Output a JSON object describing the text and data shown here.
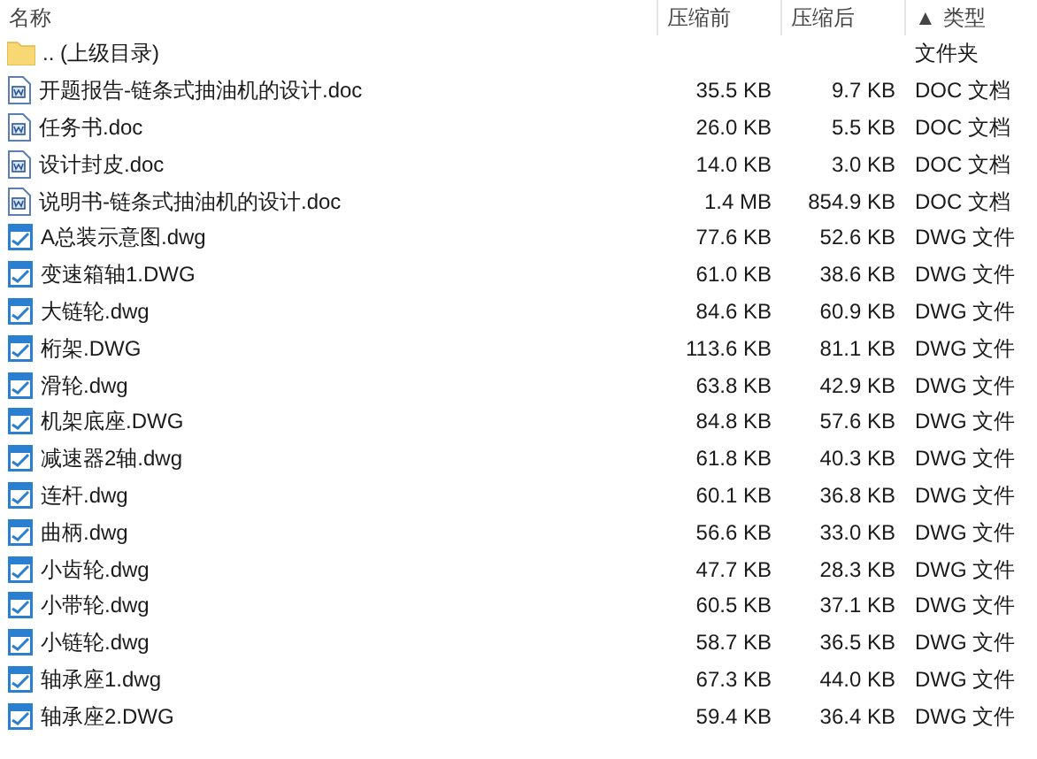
{
  "columns": [
    {
      "label": "名称"
    },
    {
      "label": "压缩前"
    },
    {
      "label": "压缩后"
    },
    {
      "label": "类型",
      "sort": "▲"
    }
  ],
  "rows": [
    {
      "kind": "folder",
      "name": ".. (上级目录)",
      "type": "文件夹"
    },
    {
      "kind": "doc",
      "name": "开题报告-链条式抽油机的设计.doc",
      "size": "35.5 KB",
      "packed": "9.7 KB",
      "type": "DOC 文档"
    },
    {
      "kind": "doc",
      "name": "任务书.doc",
      "size": "26.0 KB",
      "packed": "5.5 KB",
      "type": "DOC 文档"
    },
    {
      "kind": "doc",
      "name": "设计封皮.doc",
      "size": "14.0 KB",
      "packed": "3.0 KB",
      "type": "DOC 文档"
    },
    {
      "kind": "doc",
      "name": "说明书-链条式抽油机的设计.doc",
      "size": "1.4 MB",
      "packed": "854.9 KB",
      "type": "DOC 文档"
    },
    {
      "kind": "dwg",
      "name": "A总装示意图.dwg",
      "size": "77.6 KB",
      "packed": "52.6 KB",
      "type": "DWG 文件"
    },
    {
      "kind": "dwg",
      "name": "变速箱轴1.DWG",
      "size": "61.0 KB",
      "packed": "38.6 KB",
      "type": "DWG 文件"
    },
    {
      "kind": "dwg",
      "name": "大链轮.dwg",
      "size": "84.6 KB",
      "packed": "60.9 KB",
      "type": "DWG 文件"
    },
    {
      "kind": "dwg",
      "name": "桁架.DWG",
      "size": "113.6 KB",
      "packed": "81.1 KB",
      "type": "DWG 文件"
    },
    {
      "kind": "dwg",
      "name": "滑轮.dwg",
      "size": "63.8 KB",
      "packed": "42.9 KB",
      "type": "DWG 文件"
    },
    {
      "kind": "dwg",
      "name": "机架底座.DWG",
      "size": "84.8 KB",
      "packed": "57.6 KB",
      "type": "DWG 文件"
    },
    {
      "kind": "dwg",
      "name": "减速器2轴.dwg",
      "size": "61.8 KB",
      "packed": "40.3 KB",
      "type": "DWG 文件"
    },
    {
      "kind": "dwg",
      "name": "连杆.dwg",
      "size": "60.1 KB",
      "packed": "36.8 KB",
      "type": "DWG 文件"
    },
    {
      "kind": "dwg",
      "name": "曲柄.dwg",
      "size": "56.6 KB",
      "packed": "33.0 KB",
      "type": "DWG 文件"
    },
    {
      "kind": "dwg",
      "name": "小齿轮.dwg",
      "size": "47.7 KB",
      "packed": "28.3 KB",
      "type": "DWG 文件"
    },
    {
      "kind": "dwg",
      "name": "小带轮.dwg",
      "size": "60.5 KB",
      "packed": "37.1 KB",
      "type": "DWG 文件"
    },
    {
      "kind": "dwg",
      "name": "小链轮.dwg",
      "size": "58.7 KB",
      "packed": "36.5 KB",
      "type": "DWG 文件"
    },
    {
      "kind": "dwg",
      "name": "轴承座1.dwg",
      "size": "67.3 KB",
      "packed": "44.0 KB",
      "type": "DWG 文件"
    },
    {
      "kind": "dwg",
      "name": "轴承座2.DWG",
      "size": "59.4 KB",
      "packed": "36.4 KB",
      "type": "DWG 文件"
    }
  ]
}
